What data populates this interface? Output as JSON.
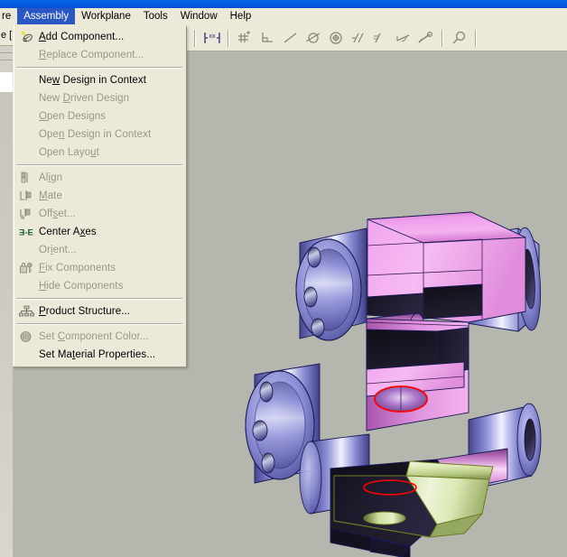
{
  "window": {
    "titlebar_color": "#0059e0",
    "menubar_bg": "#ece9d8",
    "viewport_bg": "#b5b6ae"
  },
  "left_strip": {
    "tab_label": "e ["
  },
  "menubar": {
    "items": [
      {
        "label": "re",
        "active": false,
        "clipped": true
      },
      {
        "label": "Assembly",
        "active": true,
        "clipped": false
      },
      {
        "label": "Workplane",
        "active": false,
        "clipped": false
      },
      {
        "label": "Tools",
        "active": false,
        "clipped": false
      },
      {
        "label": "Window",
        "active": false,
        "clipped": false
      },
      {
        "label": "Help",
        "active": false,
        "clipped": false
      }
    ]
  },
  "toolbar": {
    "buttons": [
      {
        "name": "dimension-xx-icon",
        "title": "Dimension"
      },
      {
        "name": "point-constraint-icon",
        "title": "Point Constraint"
      },
      {
        "name": "perpendicular-constraint-icon",
        "title": "Perpendicular"
      },
      {
        "name": "line-constraint-icon",
        "title": "Line"
      },
      {
        "name": "tangent-constraint-icon",
        "title": "Tangent"
      },
      {
        "name": "concentric-constraint-icon",
        "title": "Concentric"
      },
      {
        "name": "parallel-constraint-icon",
        "title": "Parallel"
      },
      {
        "name": "equal-constraint-icon",
        "title": "Equal"
      },
      {
        "name": "angle-constraint-icon",
        "title": "Angle"
      },
      {
        "name": "fix-constraint-icon",
        "title": "Fix"
      },
      {
        "name": "zoom-magnifier-icon",
        "title": "Zoom"
      }
    ]
  },
  "assembly_menu": {
    "items": [
      {
        "type": "item",
        "label": "Add Component...",
        "mnemonic": "A",
        "enabled": true,
        "icon": "add-component-icon"
      },
      {
        "type": "item",
        "label": "Replace Component...",
        "mnemonic": "R",
        "enabled": false,
        "icon": "none"
      },
      {
        "type": "separator"
      },
      {
        "type": "item",
        "label": "New Design in Context",
        "mnemonic": "w",
        "enabled": true,
        "icon": "none"
      },
      {
        "type": "item",
        "label": "New Driven Design",
        "mnemonic": "D",
        "enabled": false,
        "icon": "none"
      },
      {
        "type": "item",
        "label": "Open Designs",
        "mnemonic": "O",
        "enabled": false,
        "icon": "none"
      },
      {
        "type": "item",
        "label": "Open Design in Context",
        "mnemonic": "n",
        "enabled": false,
        "icon": "none"
      },
      {
        "type": "item",
        "label": "Open Layout",
        "mnemonic": "u",
        "enabled": false,
        "icon": "none"
      },
      {
        "type": "separator"
      },
      {
        "type": "item",
        "label": "Align",
        "mnemonic": "i",
        "enabled": false,
        "icon": "align-icon"
      },
      {
        "type": "item",
        "label": "Mate",
        "mnemonic": "M",
        "enabled": false,
        "icon": "mate-icon"
      },
      {
        "type": "item",
        "label": "Offset...",
        "mnemonic": "s",
        "enabled": false,
        "icon": "offset-icon"
      },
      {
        "type": "item",
        "label": "Center Axes",
        "mnemonic": "x",
        "enabled": true,
        "icon": "center-axes-icon"
      },
      {
        "type": "item",
        "label": "Orient...",
        "mnemonic": "i",
        "enabled": false,
        "icon": "none"
      },
      {
        "type": "item",
        "label": "Fix Components",
        "mnemonic": "F",
        "enabled": false,
        "icon": "fix-components-icon"
      },
      {
        "type": "item",
        "label": "Hide Components",
        "mnemonic": "H",
        "enabled": false,
        "icon": "none"
      },
      {
        "type": "separator"
      },
      {
        "type": "item",
        "label": "Product Structure...",
        "mnemonic": "P",
        "enabled": true,
        "icon": "product-structure-icon"
      },
      {
        "type": "separator"
      },
      {
        "type": "item",
        "label": "Set Component Color...",
        "mnemonic": "C",
        "enabled": false,
        "icon": "set-color-icon"
      },
      {
        "type": "item",
        "label": "Set Material Properties...",
        "mnemonic": "t",
        "enabled": true,
        "icon": "none"
      }
    ]
  },
  "model": {
    "description": "3D CAD assembly - bearing block housing with flanged bosses",
    "colors": {
      "body_pink": "#f0a8ee",
      "body_pink_dark": "#9d4fa8",
      "boss_blue": "#8a8ad8",
      "boss_blue_light": "#e8e8ff",
      "boss_blue_dark": "#4a4a9a",
      "highlight_green": "#d8e8b0",
      "highlight_green_edge": "#6a7a20",
      "selection_red": "#ff0000",
      "edge_navy": "#202060",
      "shadow_black": "#15131c"
    }
  }
}
